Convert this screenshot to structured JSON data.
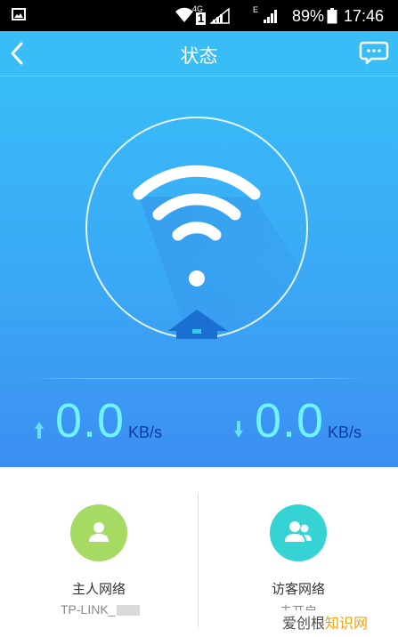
{
  "status_bar": {
    "network_type": "4G",
    "sim_slot": "1",
    "data_type": "E",
    "battery_percent": "89%",
    "time": "17:46"
  },
  "header": {
    "title": "状态",
    "back_icon": "chevron-left-icon",
    "message_icon": "chat-bubble-icon"
  },
  "hero": {
    "graphic": "wifi-router-icon",
    "upload": {
      "value": "0.0",
      "unit": "KB/s",
      "icon": "arrow-up-icon"
    },
    "download": {
      "value": "0.0",
      "unit": "KB/s",
      "icon": "arrow-down-icon"
    }
  },
  "networks": [
    {
      "name": "主人网络",
      "ssid": "TP-LINK_",
      "icon": "user-icon",
      "color": "#a6da62"
    },
    {
      "name": "访客网络",
      "status": "未开启",
      "icon": "users-icon",
      "color": "#35d3d4"
    }
  ],
  "watermark": {
    "text_a": "爱创根",
    "text_b": "知识网"
  },
  "colors": {
    "accent": "#39bdf7",
    "speed_digits": "#6ff4ff",
    "speed_unit": "#0d3a9e"
  }
}
